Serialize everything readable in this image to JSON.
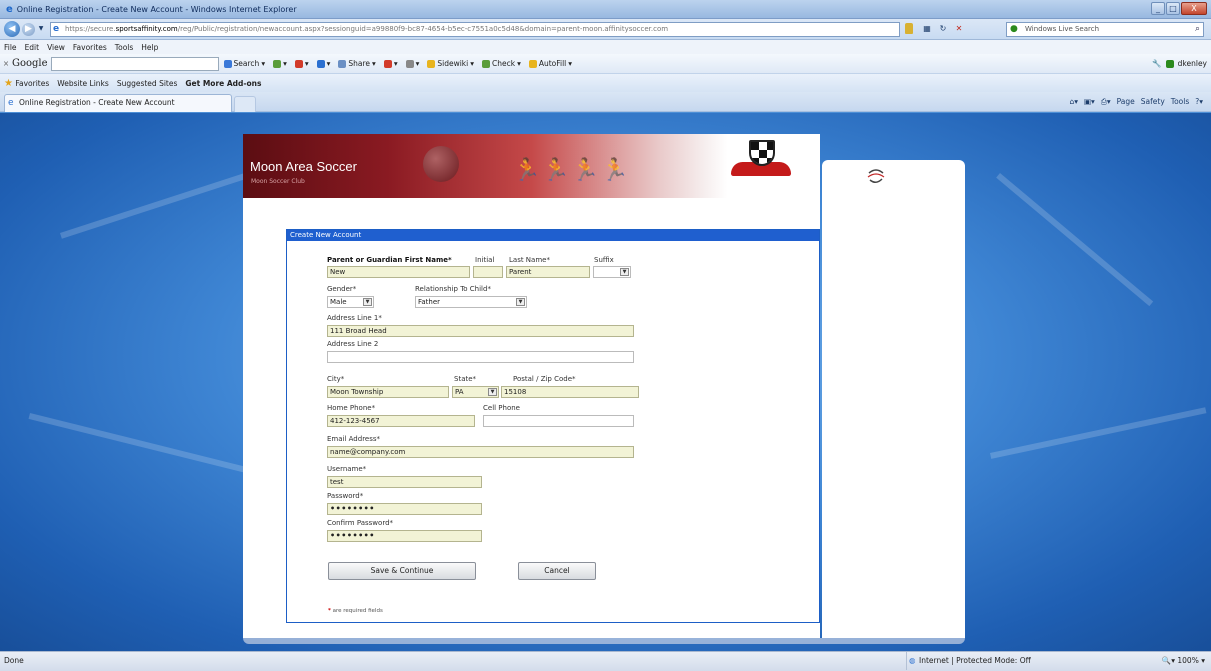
{
  "window": {
    "title": "Online Registration - Create New Account - Windows Internet Explorer",
    "controls": [
      "_",
      "□",
      "X"
    ]
  },
  "address_bar": {
    "url_prefix": "https://secure.",
    "url_domain": "sportsaffinity.com",
    "url_rest": "/reg/Public/registration/newaccount.aspx?sessionguid=a99880f9-bc87-4654-b5ec-c7551a0c5d48&domain=parent-moon.affinitysoccer.com",
    "search_placeholder": "Windows Live Search",
    "refresh_glyph": "↻",
    "stop_glyph": "✕"
  },
  "menu": [
    "File",
    "Edit",
    "View",
    "Favorites",
    "Tools",
    "Help"
  ],
  "google_toolbar": {
    "logo": "Google",
    "buttons": [
      {
        "label": "Search",
        "color": "#3a78d8"
      },
      {
        "label": "",
        "color": "#5a9d3a"
      },
      {
        "label": "",
        "color": "#d23b2a"
      },
      {
        "label": "",
        "color": "#2a6fd0"
      },
      {
        "label": "Share",
        "color": "#6a8fc4"
      },
      {
        "label": "",
        "color": "#d23b2a"
      },
      {
        "label": "",
        "color": "#888888"
      },
      {
        "label": "Sidewiki",
        "color": "#e8b41e"
      },
      {
        "label": "Check",
        "color": "#5a9d3a"
      },
      {
        "label": "AutoFill",
        "color": "#e8b41e"
      }
    ],
    "signin": "dkenley"
  },
  "favorites_bar": {
    "favorites_label": "Favorites",
    "links": [
      "Website Links",
      "Suggested Sites",
      "Get More Add-ons"
    ]
  },
  "tab": {
    "label": "Online Registration - Create New Account"
  },
  "command_bar": [
    "Page",
    "Safety",
    "Tools"
  ],
  "banner": {
    "title": "Moon Area Soccer",
    "subtitle": "Moon Soccer Club"
  },
  "form": {
    "header": "Create New Account",
    "labels": {
      "first_name": "Parent or Guardian First Name*",
      "initial": "Initial",
      "last_name": "Last Name*",
      "suffix": "Suffix",
      "gender": "Gender*",
      "relationship": "Relationship To Child*",
      "address1": "Address Line 1*",
      "address2": "Address Line 2",
      "city": "City*",
      "state": "State*",
      "zip": "Postal / Zip Code*",
      "home_phone": "Home Phone*",
      "cell_phone": "Cell Phone",
      "email": "Email Address*",
      "username": "Username*",
      "password": "Password*",
      "confirm_password": "Confirm Password*"
    },
    "values": {
      "first_name": "New",
      "initial": "",
      "last_name": "Parent",
      "suffix": "",
      "gender": "Male",
      "relationship": "Father",
      "address1": "111 Broad Head",
      "address2": "",
      "city": "Moon Township",
      "state": "PA",
      "zip": "15108",
      "home_phone": "412-123-4567",
      "cell_phone": "",
      "email": "name@company.com",
      "username": "test",
      "password": "••••••••",
      "confirm_password": "••••••••"
    },
    "buttons": {
      "save": "Save & Continue",
      "cancel": "Cancel"
    },
    "required_note_mark": "*",
    "required_note": "are required fields"
  },
  "status_bar": {
    "left": "Done",
    "zone": "Internet | Protected Mode: Off",
    "zoom": "100%"
  },
  "colors": {
    "form_header": "#1f5fcf",
    "field_fill": "#f2f3d6",
    "banner_red": "#8a1a22"
  }
}
